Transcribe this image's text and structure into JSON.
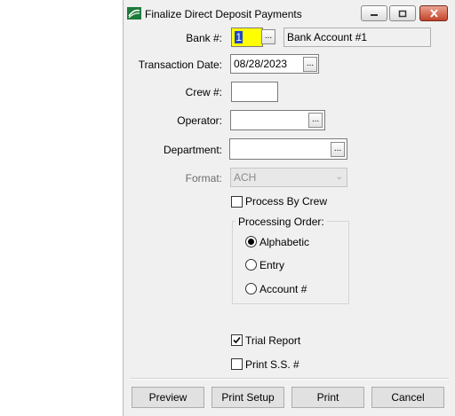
{
  "window": {
    "title": "Finalize Direct Deposit Payments",
    "icons": {
      "app": "app-logo-icon",
      "minimize": "minimize-icon",
      "maximize": "maximize-icon",
      "close": "close-icon"
    }
  },
  "form": {
    "bank": {
      "label": "Bank #:",
      "value": "1",
      "browse": "...",
      "description": "Bank Account #1"
    },
    "transaction_date": {
      "label": "Transaction Date:",
      "value": "08/28/2023",
      "browse": "..."
    },
    "crew": {
      "label": "Crew #:",
      "value": ""
    },
    "operator": {
      "label": "Operator:",
      "value": "",
      "browse": "..."
    },
    "department": {
      "label": "Department:",
      "value": "",
      "browse": "..."
    },
    "format": {
      "label": "Format:",
      "value": "ACH"
    },
    "process_by_crew": {
      "label": "Process By Crew",
      "checked": false
    },
    "processing_order": {
      "title": "Processing Order:",
      "options": [
        {
          "label": "Alphabetic",
          "selected": true
        },
        {
          "label": "Entry",
          "selected": false
        },
        {
          "label": "Account #",
          "selected": false
        }
      ]
    },
    "trial_report": {
      "label": "Trial Report",
      "checked": true
    },
    "print_ss": {
      "label": "Print S.S. #",
      "checked": false
    }
  },
  "buttons": {
    "preview": "Preview",
    "print_setup": "Print Setup",
    "print": "Print",
    "cancel": "Cancel"
  },
  "colors": {
    "highlight_field": "#ffff00",
    "close_button": "#c4432a"
  }
}
